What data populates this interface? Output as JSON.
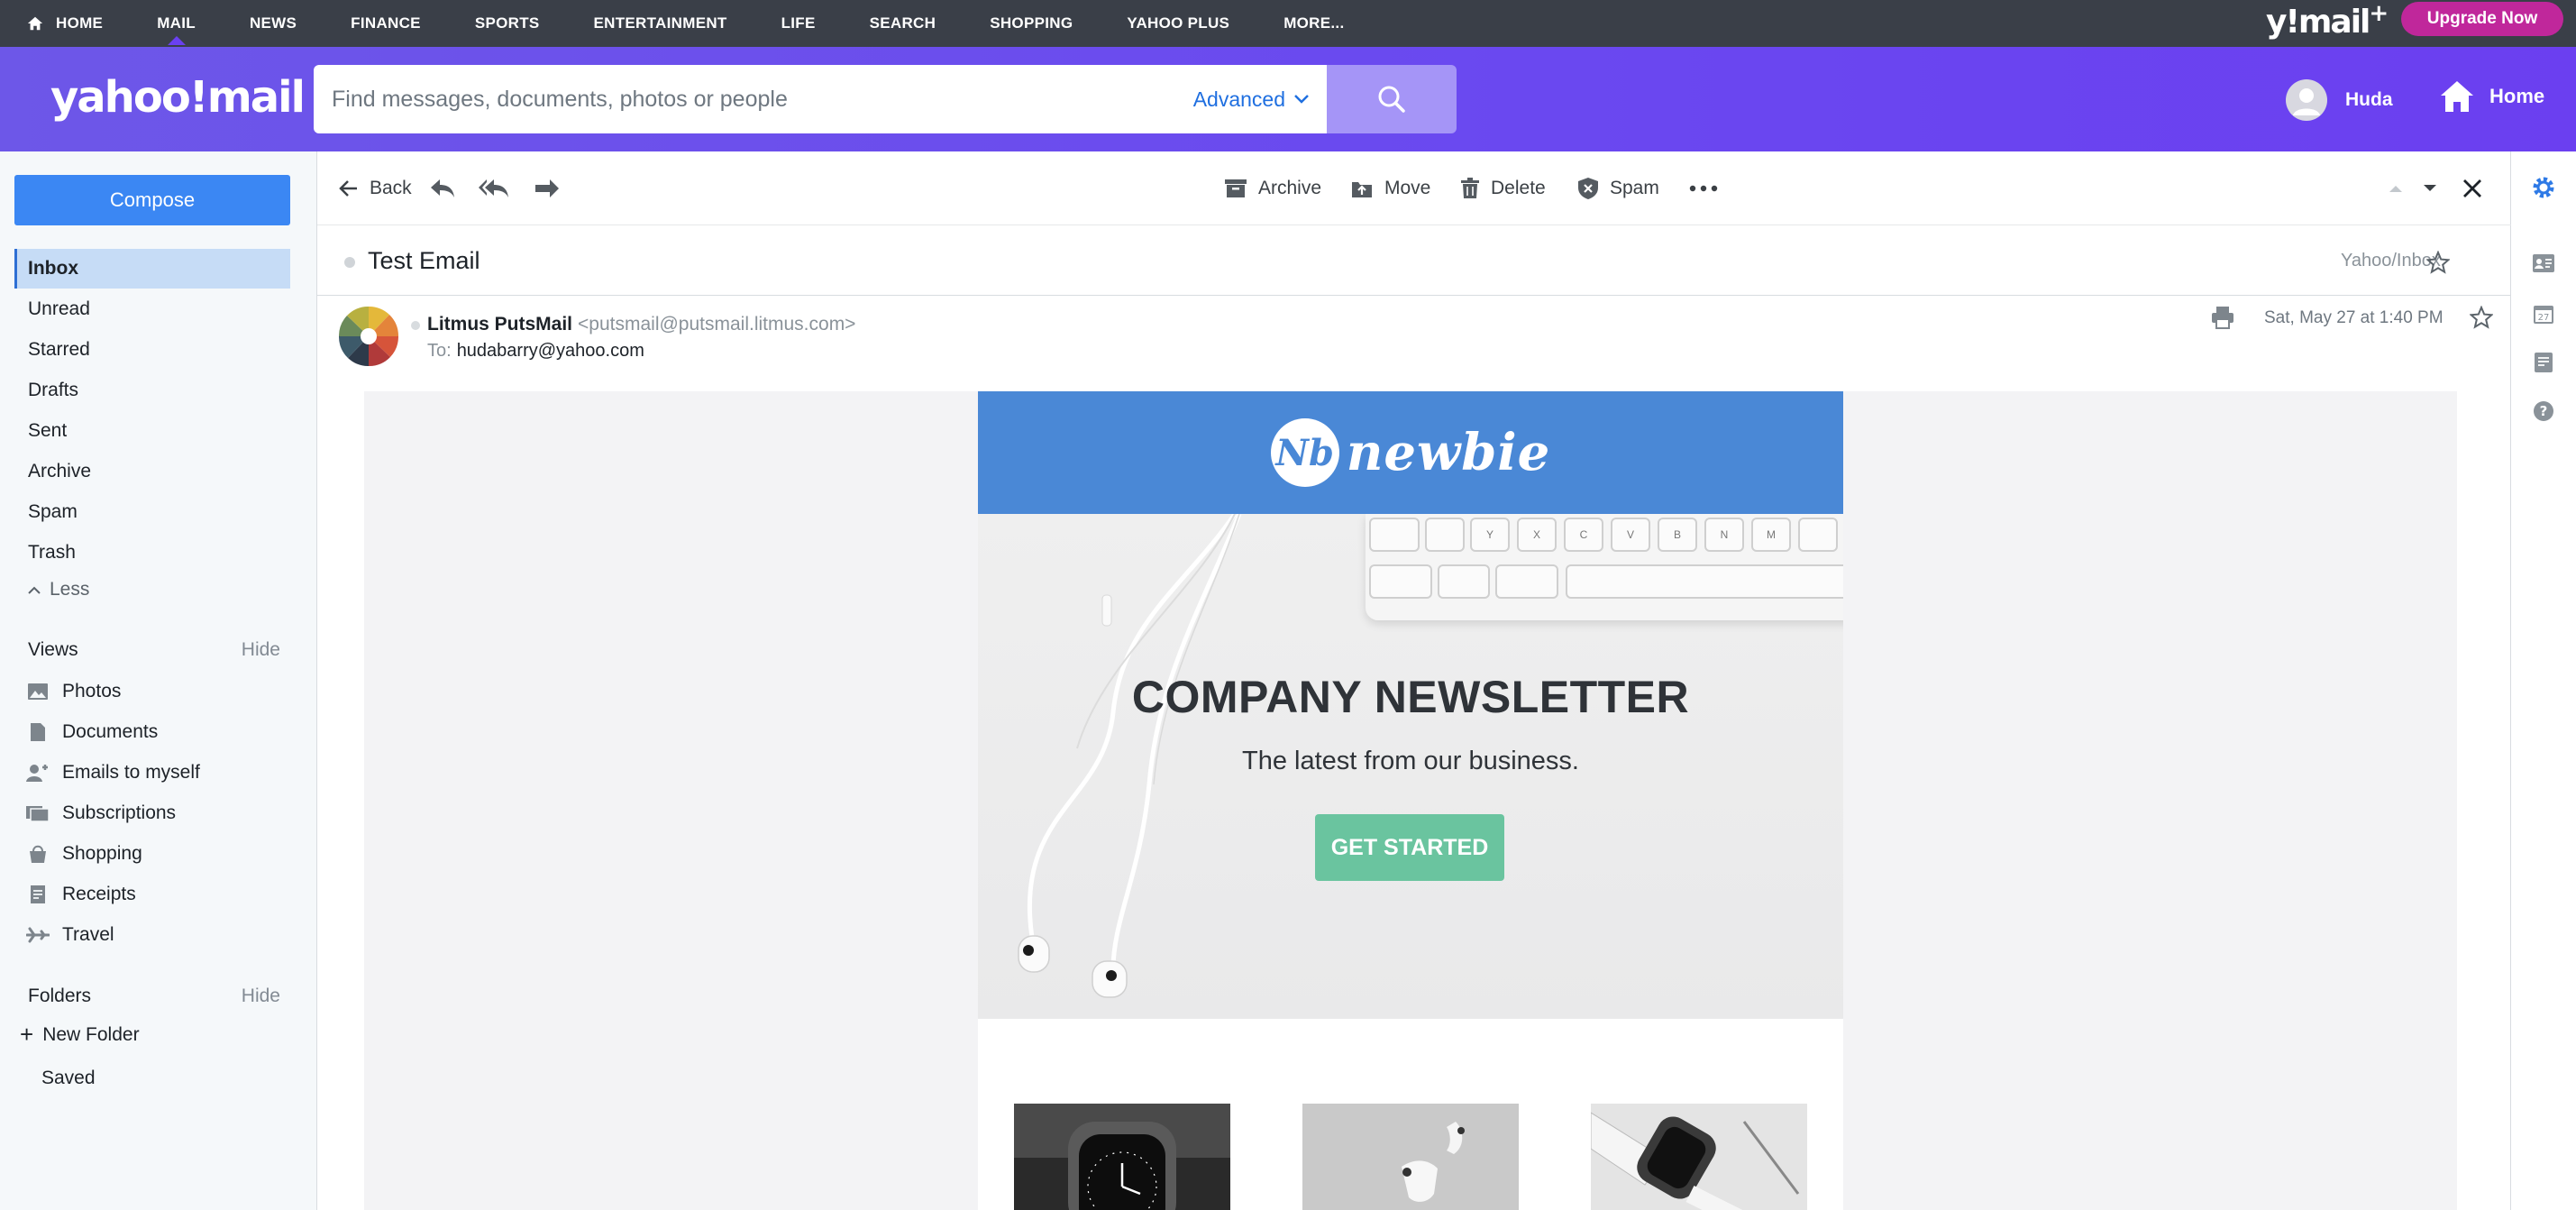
{
  "topnav": {
    "links": [
      "HOME",
      "MAIL",
      "NEWS",
      "FINANCE",
      "SPORTS",
      "ENTERTAINMENT",
      "LIFE",
      "SEARCH",
      "SHOPPING",
      "YAHOO PLUS",
      "MORE..."
    ],
    "brand": "y!mail",
    "brand_plus": "+",
    "upgrade": "Upgrade Now",
    "upgrade_color": "#c0279b"
  },
  "header": {
    "logo": "yahoo!mail",
    "search_placeholder": "Find messages, documents, photos or people",
    "advanced": "Advanced",
    "user_name": "Huda",
    "home": "Home",
    "accent": "#6a48f0"
  },
  "sidebar": {
    "compose": "Compose",
    "folders": [
      "Inbox",
      "Unread",
      "Starred",
      "Drafts",
      "Sent",
      "Archive",
      "Spam",
      "Trash"
    ],
    "less": "Less",
    "views_title": "Views",
    "views_hide": "Hide",
    "views": [
      {
        "label": "Photos",
        "icon": "photo-icon"
      },
      {
        "label": "Documents",
        "icon": "document-icon"
      },
      {
        "label": "Emails to myself",
        "icon": "people-icon"
      },
      {
        "label": "Subscriptions",
        "icon": "subscriptions-icon"
      },
      {
        "label": "Shopping",
        "icon": "shopping-bag-icon"
      },
      {
        "label": "Receipts",
        "icon": "receipt-icon"
      },
      {
        "label": "Travel",
        "icon": "plane-icon"
      }
    ],
    "folders_title": "Folders",
    "folders_hide": "Hide",
    "new_folder": "New Folder",
    "custom_folders": [
      "Saved"
    ]
  },
  "toolbar": {
    "back": "Back",
    "archive": "Archive",
    "move": "Move",
    "delete": "Delete",
    "spam": "Spam"
  },
  "message": {
    "subject": "Test Email",
    "folder": "Yahoo/Inbox",
    "sender_name": "Litmus PutsMail",
    "sender_email": "<putsmail@putsmail.litmus.com>",
    "to_label": "To:",
    "to": "hudabarry@yahoo.com",
    "date": "Sat, May 27 at 1:40 PM"
  },
  "email": {
    "brand_mark": "Nb",
    "brand_word": "newbie",
    "title": "COMPANY NEWSLETTER",
    "subtitle": "The latest from our business.",
    "cta": "GET STARTED",
    "cta_color": "#6ac49f",
    "banner_color": "#4a88d6",
    "keyboard_keys": [
      "Y",
      "X",
      "C",
      "V",
      "B",
      "N",
      "M"
    ]
  }
}
